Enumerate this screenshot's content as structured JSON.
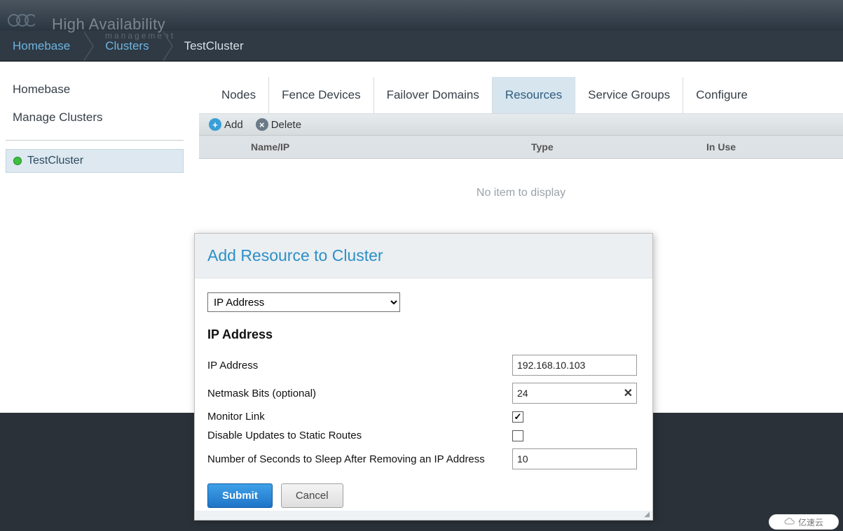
{
  "logo": {
    "main": "High Availability",
    "sub": "management"
  },
  "breadcrumbs": [
    "Homebase",
    "Clusters",
    "TestCluster"
  ],
  "sidebar": {
    "links": [
      "Homebase",
      "Manage Clusters"
    ],
    "cluster": "TestCluster"
  },
  "tabs": [
    "Nodes",
    "Fence Devices",
    "Failover Domains",
    "Resources",
    "Service Groups",
    "Configure"
  ],
  "active_tab": "Resources",
  "toolbar": {
    "add": "Add",
    "delete": "Delete"
  },
  "table": {
    "headers": [
      "Name/IP",
      "Type",
      "In Use"
    ],
    "empty": "No item to display"
  },
  "modal": {
    "title": "Add Resource to Cluster",
    "type_selected": "IP Address",
    "section": "IP Address",
    "fields": {
      "ip_label": "IP Address",
      "ip_value": "192.168.10.103",
      "netmask_label": "Netmask Bits (optional)",
      "netmask_value": "24",
      "monitor_label": "Monitor Link",
      "monitor_checked": true,
      "disable_label": "Disable Updates to Static Routes",
      "disable_checked": false,
      "sleep_label": "Number of Seconds to Sleep After Removing an IP Address",
      "sleep_value": "10"
    },
    "submit": "Submit",
    "cancel": "Cancel"
  },
  "watermark": "亿速云"
}
